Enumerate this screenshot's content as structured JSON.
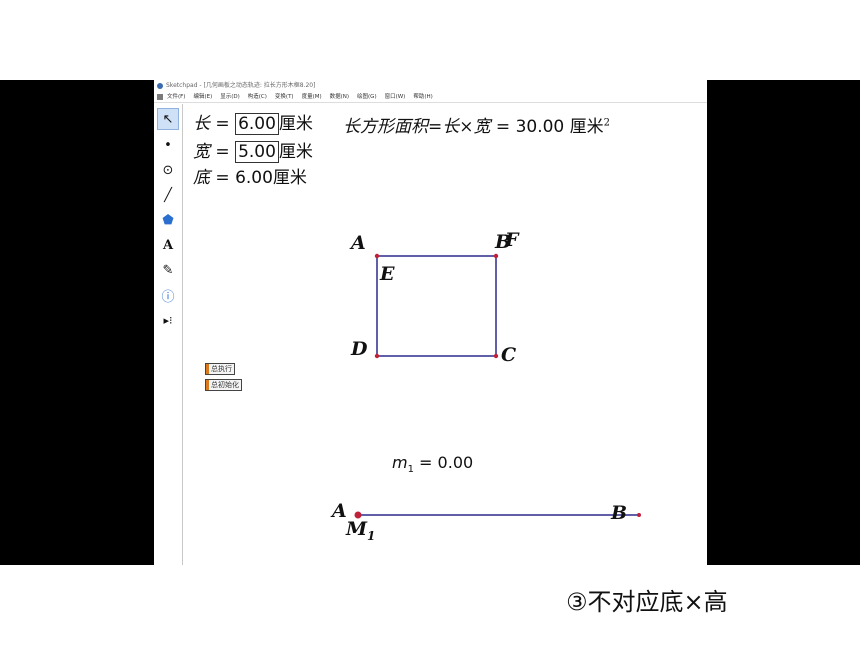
{
  "window": {
    "title": "Sketchpad - [几何画板之动态轨迹: 拉长方形木框8.20]"
  },
  "menu": [
    "文件(F)",
    "编辑(E)",
    "显示(D)",
    "构造(C)",
    "变换(T)",
    "度量(M)",
    "数据(N)",
    "绘图(G)",
    "窗口(W)",
    "帮助(H)"
  ],
  "tools": [
    {
      "name": "arrow-select-tool-icon",
      "glyph": "↖"
    },
    {
      "name": "point-tool-icon",
      "glyph": "•"
    },
    {
      "name": "compass-tool-icon",
      "glyph": "⊙"
    },
    {
      "name": "straightedge-tool-icon",
      "glyph": "╱"
    },
    {
      "name": "polygon-tool-icon",
      "glyph": "⬟"
    },
    {
      "name": "text-tool-icon",
      "glyph": "A"
    },
    {
      "name": "marker-tool-icon",
      "glyph": "✎"
    },
    {
      "name": "info-tool-icon",
      "glyph": "ⓘ"
    },
    {
      "name": "custom-tool-icon",
      "glyph": "▸⁝"
    }
  ],
  "measurements": {
    "length": {
      "label": "长",
      "eq": " = ",
      "value": "6.00",
      "unit": "厘米"
    },
    "width": {
      "label": "宽",
      "eq": " = ",
      "value": "5.00",
      "unit": "厘米"
    },
    "base": {
      "label": "底",
      "eq": " = ",
      "value": "6.00",
      "unit": "厘米"
    },
    "area": {
      "label": "长方形面积",
      "formula": "=长×宽",
      "eq": " = ",
      "value": "30.00",
      "unit": "厘米",
      "exp": "2"
    }
  },
  "buttons": {
    "execute": "总执行",
    "init": "总初始化"
  },
  "points": {
    "A": "A",
    "B": "B",
    "F": "F",
    "E": "E",
    "D": "D",
    "C": "C",
    "seg_A": "A",
    "seg_B": "B",
    "M": "M",
    "M_sub": "1"
  },
  "m1": {
    "label": "m",
    "sub": "1",
    "eq": " = ",
    "value": "0.00"
  },
  "caption": "③不对应底×高",
  "colors": {
    "shape": "#2b2a8a",
    "point": "#c0203a"
  }
}
